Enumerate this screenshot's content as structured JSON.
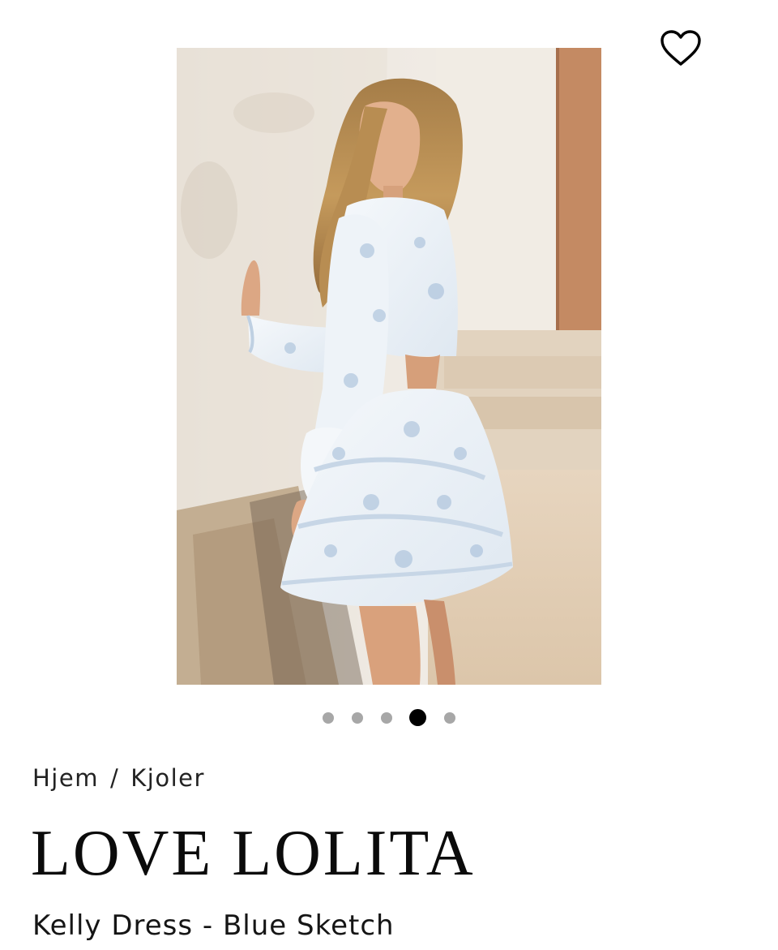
{
  "product_gallery": {
    "image_alt": "Model wearing white ruffled dress with blue floral sketch print, leaning on a wall",
    "slide_count": 5,
    "active_slide": 4
  },
  "wishlist": {
    "icon": "heart-outline-icon",
    "label": "Legg til ønskeliste"
  },
  "breadcrumb": {
    "items": [
      "Hjem",
      "Kjoler"
    ],
    "separator": "/"
  },
  "product": {
    "brand": "LOVE LOLITA",
    "name": "Kelly Dress - Blue Sketch"
  },
  "colors": {
    "active_dot": "#000000",
    "inactive_dot": "#a7a7a7",
    "text": "#111111"
  }
}
